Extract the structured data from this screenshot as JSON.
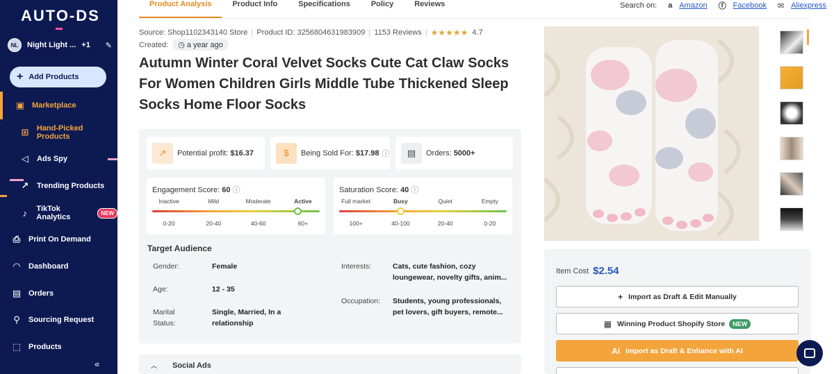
{
  "sidebar": {
    "logo": "AUTO-DS",
    "store": {
      "initials": "NL",
      "name": "Night Light ...",
      "extra": "+1"
    },
    "add_products": "Add Products",
    "items": [
      {
        "label": "Marketplace",
        "icon": "store-icon"
      },
      {
        "label": "Hand-Picked Products",
        "icon": "hand-picked-icon"
      },
      {
        "label": "Ads Spy",
        "icon": "megaphone-icon"
      },
      {
        "label": "Trending Products",
        "icon": "trend-icon"
      },
      {
        "label": "TikTok Analytics",
        "icon": "tiktok-icon",
        "badge": "NEW"
      },
      {
        "label": "Print On Demand",
        "icon": "print-icon"
      },
      {
        "label": "Dashboard",
        "icon": "gauge-icon"
      },
      {
        "label": "Orders",
        "icon": "orders-icon"
      },
      {
        "label": "Sourcing Request",
        "icon": "sourcing-icon"
      },
      {
        "label": "Products",
        "icon": "products-icon"
      }
    ]
  },
  "tabs": [
    "Product Analysis",
    "Product Info",
    "Specifications",
    "Policy",
    "Reviews"
  ],
  "search_on": {
    "label": "Search on:",
    "amazon": "Amazon",
    "facebook": "Facebook",
    "aliexpress": "Aliexpress"
  },
  "product": {
    "source": "Source: Shop1102343140 Store",
    "product_id": "Product ID: 3256804631983909",
    "reviews": "1153 Reviews",
    "rating": "4.7",
    "created_label": "Created:",
    "created_value": "a year ago",
    "title": "Autumn Winter Coral Velvet Socks Cute Cat Claw Socks For Women Children Girls Middle Tube Thickened Sleep Socks Home Floor Socks"
  },
  "stats": {
    "profit_label": "Potential profit:",
    "profit_value": "$16.37",
    "sold_label": "Being Sold For:",
    "sold_value": "$17.98",
    "orders_label": "Orders:",
    "orders_value": "5000+"
  },
  "engagement": {
    "label": "Engagement Score:",
    "value": "60",
    "levels": [
      "Inactive",
      "Mild",
      "Moderate",
      "Active"
    ],
    "ticks": [
      "0-20",
      "20-40",
      "40-60",
      "60+"
    ],
    "position": 0.87
  },
  "saturation": {
    "label": "Saturation Score:",
    "value": "40",
    "levels": [
      "Full market",
      "Busy",
      "Quiet",
      "Empty"
    ],
    "ticks": [
      "100+",
      "40-100",
      "20-40",
      "0-20"
    ],
    "position": 0.37
  },
  "audience": {
    "title": "Target Audience",
    "gender_label": "Gender:",
    "gender": "Female",
    "age_label": "Age:",
    "age": "12 - 35",
    "marital_label": "Marital Status:",
    "marital": "Single, Married, In a relationship",
    "interests_label": "Interests:",
    "interests": "Cats, cute fashion, cozy loungewear, novelty gifts, anim...",
    "occupation_label": "Occupation:",
    "occupation": "Students, young professionals, pet lovers, gift buyers, remote..."
  },
  "social_ads": "Social Ads",
  "buy": {
    "item_cost_label": "Item Cost",
    "item_cost": "$2.54",
    "import_manual": "Import as Draft & Edit Manually",
    "winning_store": "Winning Product Shopify Store",
    "winning_badge": "NEW",
    "import_ai": "Import as Draft & Enhance with AI"
  },
  "colors": {
    "accent": "#f3a43b",
    "sidebar": "#0d1a52",
    "link": "#2457c5",
    "price": "#2457c5"
  }
}
